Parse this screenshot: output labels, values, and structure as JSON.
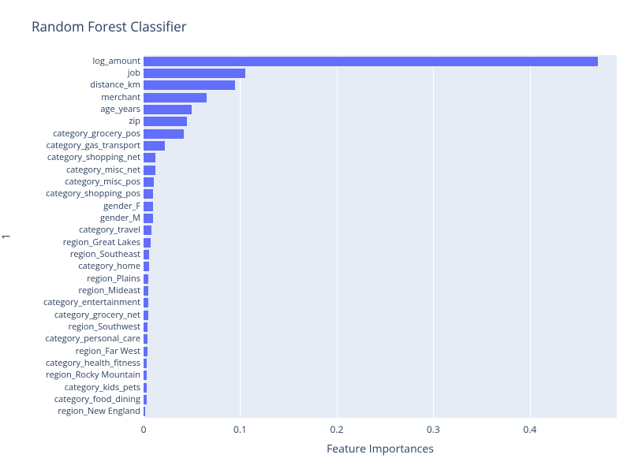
{
  "chart_data": {
    "type": "bar",
    "title": "Random Forest Classifier",
    "xlabel": "Feature Importances",
    "ylabel": "1",
    "xlim": [
      0,
      0.49
    ],
    "xticks": [
      0,
      0.1,
      0.2,
      0.3,
      0.4
    ],
    "categories": [
      "log_amount",
      "job",
      "distance_km",
      "merchant",
      "age_years",
      "zip",
      "category_grocery_pos",
      "category_gas_transport",
      "category_shopping_net",
      "category_misc_net",
      "category_misc_pos",
      "category_shopping_pos",
      "gender_F",
      "gender_M",
      "category_travel",
      "region_Great Lakes",
      "region_Southeast",
      "category_home",
      "region_Plains",
      "region_Mideast",
      "category_entertainment",
      "category_grocery_net",
      "region_Southwest",
      "category_personal_care",
      "region_Far West",
      "category_health_fitness",
      "region_Rocky Mountain",
      "category_kids_pets",
      "category_food_dining",
      "region_New England"
    ],
    "values": [
      0.47,
      0.105,
      0.095,
      0.065,
      0.05,
      0.045,
      0.042,
      0.022,
      0.012,
      0.012,
      0.011,
      0.01,
      0.01,
      0.01,
      0.008,
      0.007,
      0.006,
      0.006,
      0.005,
      0.005,
      0.005,
      0.005,
      0.004,
      0.004,
      0.004,
      0.003,
      0.003,
      0.003,
      0.003,
      0.002
    ]
  }
}
